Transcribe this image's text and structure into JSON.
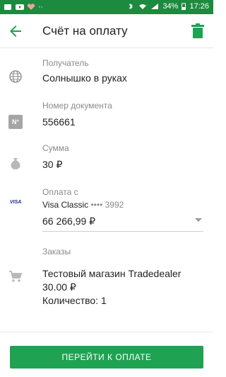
{
  "status": {
    "battery": "34%",
    "time": "17:26"
  },
  "header": {
    "title": "Счёт на оплату"
  },
  "recipient": {
    "label": "Получатель",
    "value": "Солнышко в руках"
  },
  "document": {
    "label": "Номер документа",
    "value": "556661",
    "icon_text": "N°"
  },
  "amount": {
    "label": "Сумма",
    "value": "30 ₽"
  },
  "payment_from": {
    "label": "Оплата с",
    "card_brand": "VISA",
    "card_name": "Visa Classic",
    "card_mask": "•••• 3992",
    "balance": "66 266,99 ₽"
  },
  "orders": {
    "label": "Заказы",
    "shop": "Тестовый магазин Tradedealer",
    "price": "30.00 ₽",
    "quantity": "Количество: 1"
  },
  "action": {
    "pay_label": "ПЕРЕЙТИ К ОПЛАТЕ"
  },
  "colors": {
    "brand": "#1c8a3f",
    "button": "#1fa252"
  }
}
